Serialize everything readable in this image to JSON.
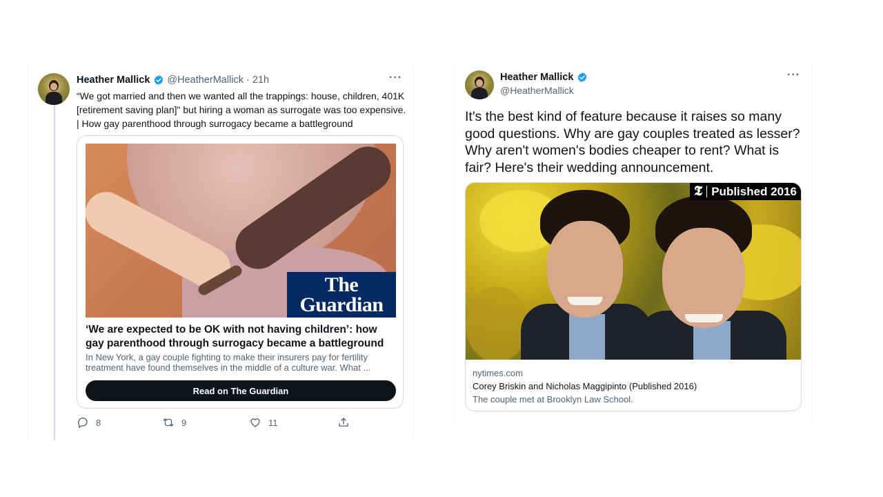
{
  "left_tweet": {
    "name": "Heather Mallick",
    "handle": "@HeatherMallick · 21h",
    "more": "···",
    "text": "“We got married and then we wanted all the trappings: house, children, 401K [retirement saving plan]\" but hiring a woman as surrogate was too expensive. | How gay parenthood through surrogacy became a battleground",
    "card": {
      "logo_line1": "The",
      "logo_line2": "Guardian",
      "title": "‘We are expected to be OK with not having children’: how gay parenthood through surrogacy became a battleground",
      "description": "In New York, a gay couple fighting to make their insurers pay for fertility treatment have found themselves in the middle of a culture war. What ...",
      "button": "Read on The Guardian"
    },
    "actions": {
      "replies": "8",
      "retweets": "9",
      "likes": "11"
    }
  },
  "right_tweet": {
    "name": "Heather Mallick",
    "handle": "@HeatherMallick",
    "more": "···",
    "text": "It's the best kind of feature because it raises so many good questions. Why are gay couples treated as lesser? Why aren't women's bodies cheaper to rent? What is fair? Here's their wedding announcement.",
    "card": {
      "badge_logo": "𝕿",
      "badge_text": "Published 2016",
      "domain": "nytimes.com",
      "title": "Corey Briskin and Nicholas Maggipinto (Published 2016)",
      "description": "The couple met at Brooklyn Law School."
    }
  },
  "colors": {
    "verified": "#1d9bf0",
    "guardian_blue": "#052962",
    "secondary_text": "#536471",
    "border": "#cfd9de"
  },
  "icons": [
    "verified-badge-icon",
    "more-icon",
    "reply-icon",
    "retweet-icon",
    "like-icon",
    "share-icon"
  ]
}
